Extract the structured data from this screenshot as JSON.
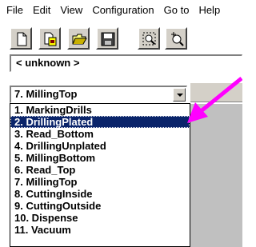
{
  "menubar": {
    "items": [
      "File",
      "Edit",
      "View",
      "Configuration",
      "Go to",
      "Help"
    ]
  },
  "toolbar": {
    "buttons": [
      "new-file-icon",
      "new-page-icon",
      "open-folder-icon",
      "save-disk-icon",
      "zoom-window-icon",
      "zoom-in-icon"
    ]
  },
  "location_combo": {
    "value": "< unknown >"
  },
  "layer_combo": {
    "value": "7. MillingTop",
    "selected_index": 1,
    "options": [
      "1. MarkingDrills",
      "2. DrillingPlated",
      "3. Read_Bottom",
      "4. DrillingUnplated",
      "5. MillingBottom",
      "6. Read_Top",
      "7. MillingTop",
      "8. CuttingInside",
      "9. CuttingOutside",
      "10. Dispense",
      "11. Vacuum"
    ]
  },
  "colors": {
    "highlight": "#0a246a",
    "annotation_arrow": "#ff00ff",
    "chrome": "#d4d0c8"
  }
}
